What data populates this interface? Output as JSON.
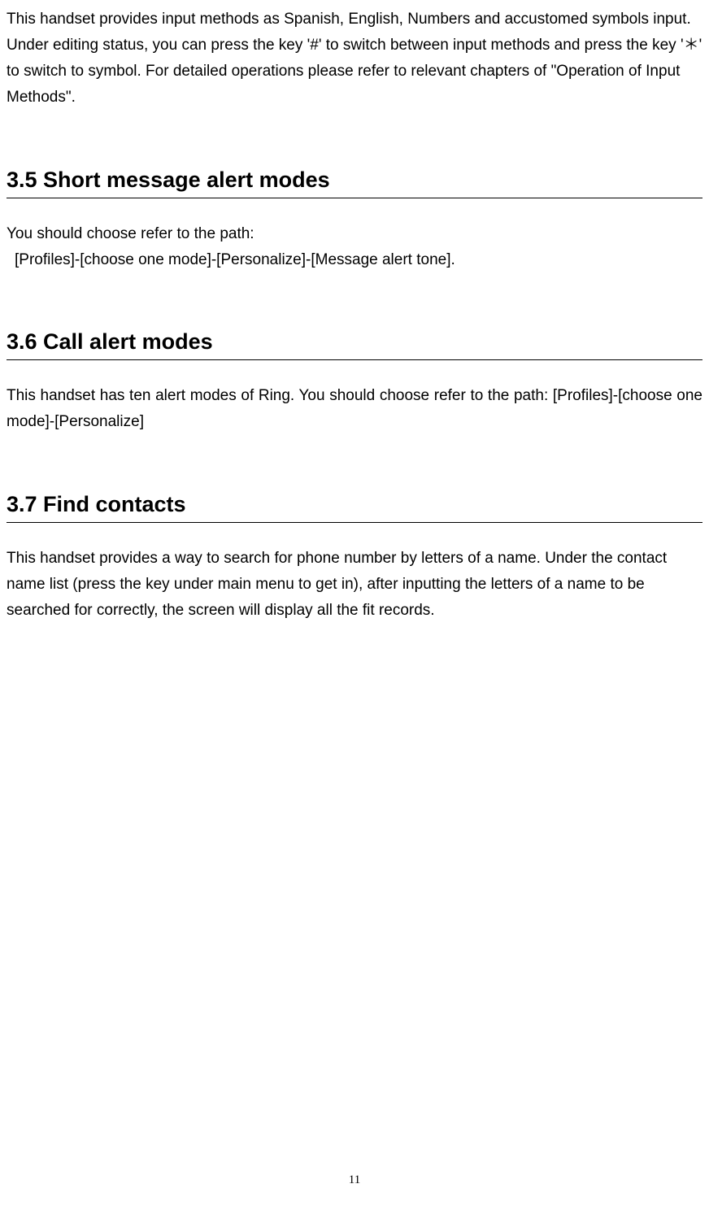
{
  "intro": "This handset provides input methods as Spanish, English, Numbers and accustomed symbols input. Under editing status, you can press the key '#' to switch between input methods and press the key '＊' to switch to symbol. For detailed operations please refer to relevant chapters of \"Operation of Input Methods\".",
  "sections": [
    {
      "heading": "3.5 Short message alert modes",
      "body_line1": "You should choose refer to the path:",
      "body_line2": "[Profiles]-[choose one mode]-[Personalize]-[Message alert tone]."
    },
    {
      "heading": "3.6 Call alert modes",
      "body": "This handset has ten alert modes of Ring.  You should choose refer to the path: [Profiles]-[choose one mode]-[Personalize]"
    },
    {
      "heading": "3.7 Find contacts",
      "body": "This handset provides a way to search for phone number by letters of a name. Under the contact name list (press the key under main menu to get in), after inputting the letters of a name to be searched for correctly, the screen will display all the fit records."
    }
  ],
  "page_number": "11"
}
